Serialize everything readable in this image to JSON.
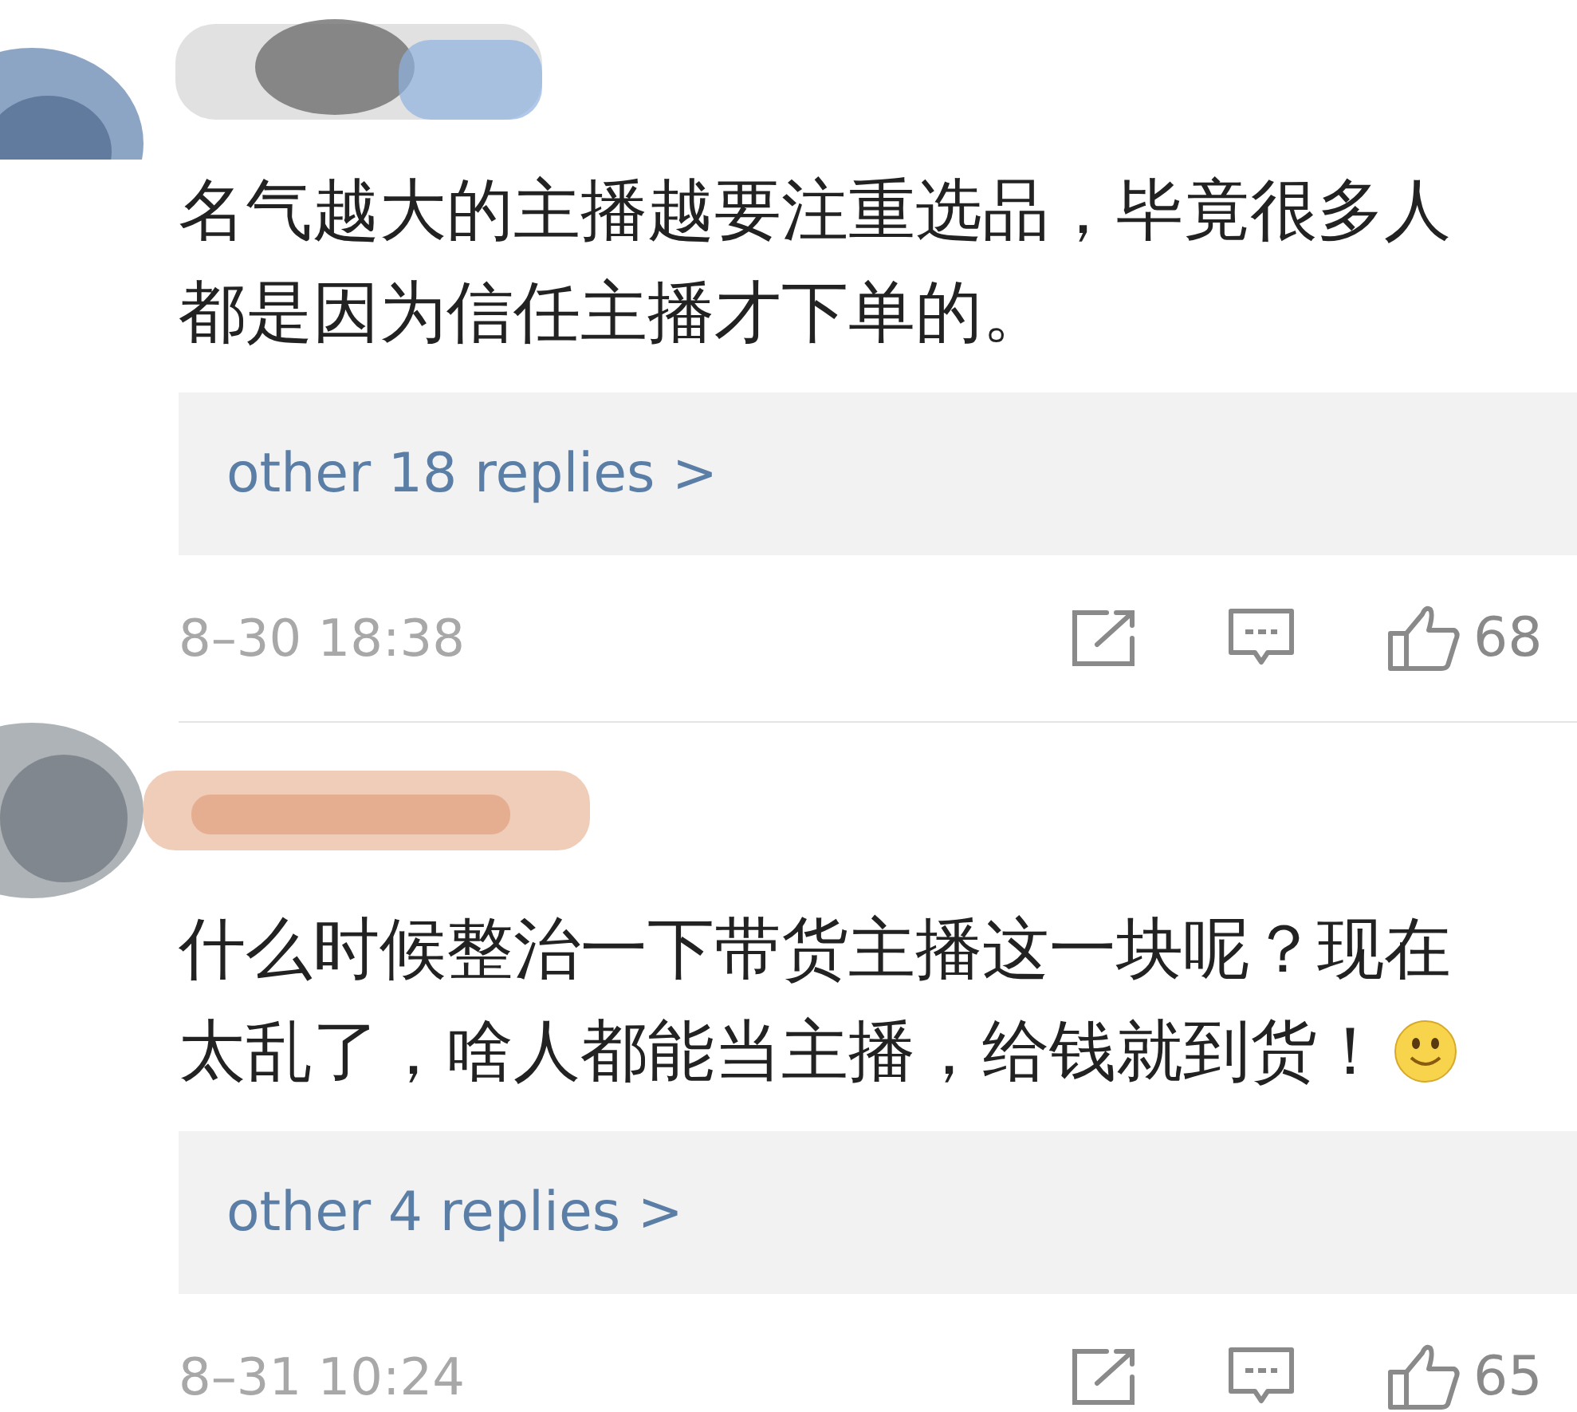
{
  "comments": [
    {
      "text_lines": [
        "名气越大的主播越要注重选品，毕竟很多人",
        "都是因为信任主播才下单的。"
      ],
      "emoji": false,
      "replies_link": "other 18 replies >",
      "time": "8–30 18:38",
      "likes": "68"
    },
    {
      "text_lines": [
        "什么时候整治一下带货主播这一块呢？现在",
        "太乱了，啥人都能当主播，给钱就到货！"
      ],
      "emoji": true,
      "replies_link": "other 4 replies >",
      "time": "8–31 10:24",
      "likes": "65"
    }
  ]
}
